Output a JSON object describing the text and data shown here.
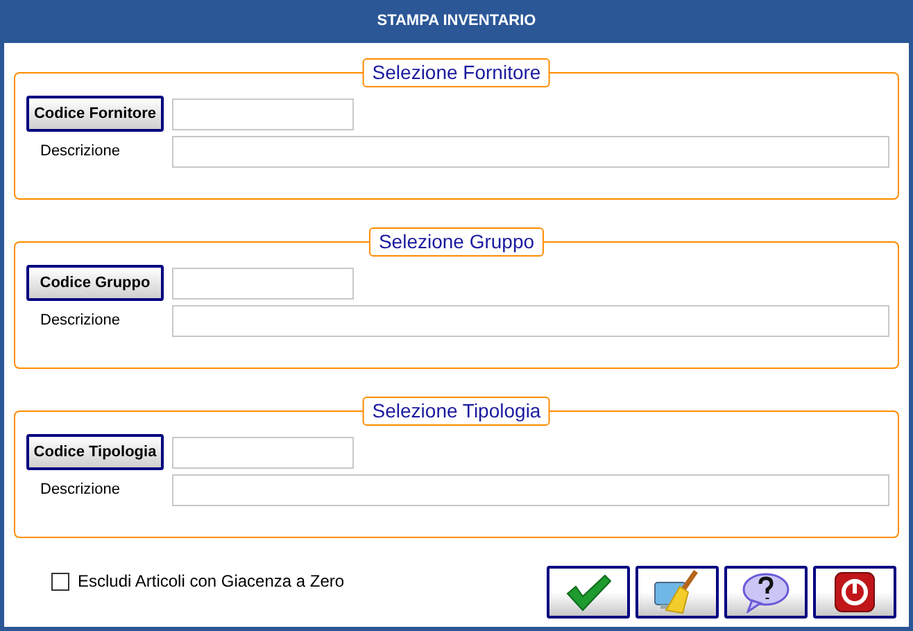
{
  "window": {
    "title": "STAMPA INVENTARIO"
  },
  "groups": [
    {
      "legend": "Selezione Fornitore",
      "code_button": "Codice Fornitore",
      "description_label": "Descrizione"
    },
    {
      "legend": "Selezione Gruppo",
      "code_button": "Codice Gruppo",
      "description_label": "Descrizione"
    },
    {
      "legend": "Selezione Tipologia",
      "code_button": "Codice Tipologia",
      "description_label": "Descrizione"
    }
  ],
  "exclude_zero_stock": {
    "label": "Escludi Articoli con Giacenza a Zero",
    "checked": false
  },
  "actions": [
    {
      "kind": "confirm"
    },
    {
      "kind": "clear"
    },
    {
      "kind": "help"
    },
    {
      "kind": "exit"
    }
  ]
}
